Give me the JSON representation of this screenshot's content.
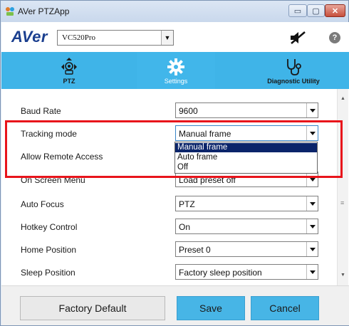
{
  "window": {
    "title": "AVer PTZApp",
    "minimize_glyph": "▭",
    "maximize_glyph": "▢",
    "close_glyph": "✕"
  },
  "header": {
    "logo": "AVer",
    "model": "VC520Pro",
    "help_glyph": "?"
  },
  "toolbar": {
    "tabs": [
      {
        "label": "PTZ",
        "icon": "camera-ptz-icon"
      },
      {
        "label": "Settings",
        "icon": "gear-icon",
        "active": true
      },
      {
        "label": "Diagnostic Utility",
        "icon": "stethoscope-icon"
      }
    ]
  },
  "settings": {
    "rows": [
      {
        "label": "Baud Rate",
        "value": "9600"
      },
      {
        "label": "Tracking mode",
        "value": "Manual frame"
      },
      {
        "label": "Allow Remote Access",
        "value": ""
      },
      {
        "label": "On Screen Menu",
        "value": "Load preset off"
      },
      {
        "label": "Auto Focus",
        "value": "PTZ"
      },
      {
        "label": "Hotkey Control",
        "value": "On"
      },
      {
        "label": "Home Position",
        "value": "Preset 0"
      },
      {
        "label": "Sleep Position",
        "value": "Factory sleep position"
      }
    ],
    "tracking_dropdown": {
      "options": [
        "Manual frame",
        "Auto frame",
        "Off"
      ],
      "selected": "Manual frame"
    }
  },
  "footer": {
    "factory_default": "Factory Default",
    "save": "Save",
    "cancel": "Cancel"
  },
  "colors": {
    "toolbar_blue": "#3fb4e8",
    "button_blue": "#47b5e6",
    "highlight_red": "#e8141b",
    "selected_item": "#0a246a"
  }
}
